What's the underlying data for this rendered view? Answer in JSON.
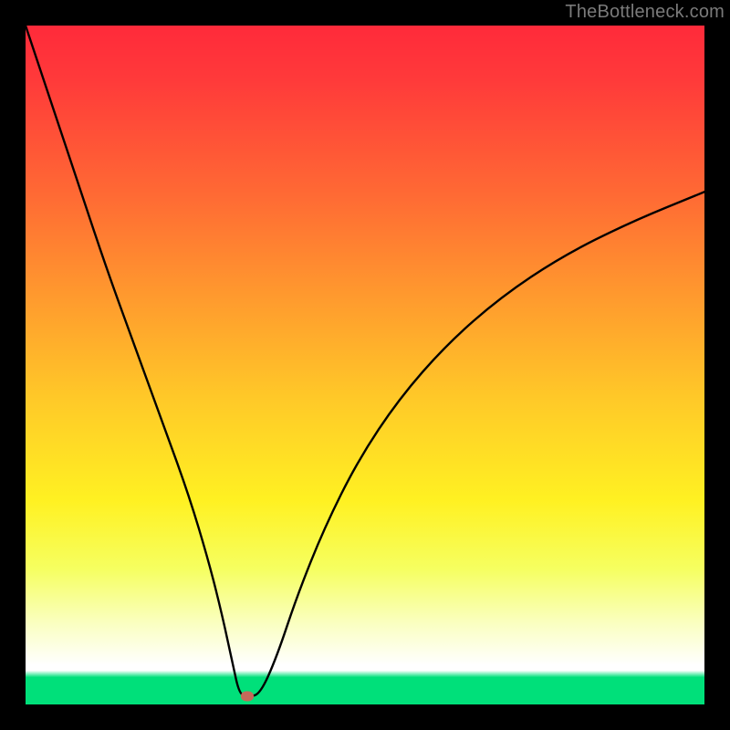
{
  "watermark": "TheBottleneck.com",
  "chart_data": {
    "type": "line",
    "title": "",
    "xlabel": "",
    "ylabel": "",
    "xlim": [
      0,
      100
    ],
    "ylim": [
      0,
      100
    ],
    "series": [
      {
        "name": "bottleneck-curve",
        "x": [
          0.0,
          4.0,
          8.0,
          12.0,
          16.0,
          20.0,
          24.0,
          27.0,
          29.0,
          30.5,
          31.5,
          32.7,
          34.5,
          37.0,
          40.0,
          44.0,
          49.0,
          55.0,
          62.0,
          70.0,
          79.0,
          89.0,
          100.0
        ],
        "values": [
          100.0,
          88.0,
          76.0,
          64.0,
          53.0,
          42.0,
          31.0,
          21.0,
          13.0,
          6.0,
          1.5,
          1.2,
          1.4,
          7.0,
          16.0,
          26.0,
          36.0,
          45.0,
          53.0,
          60.0,
          66.0,
          71.0,
          75.5
        ]
      }
    ],
    "marker": {
      "x": 32.7,
      "y": 1.2
    },
    "colors": {
      "curve": "#000000",
      "marker": "#c46a5a",
      "gradient_top": "#ff2a3a",
      "gradient_mid": "#fff122",
      "gradient_bottom": "#00e07a"
    }
  }
}
